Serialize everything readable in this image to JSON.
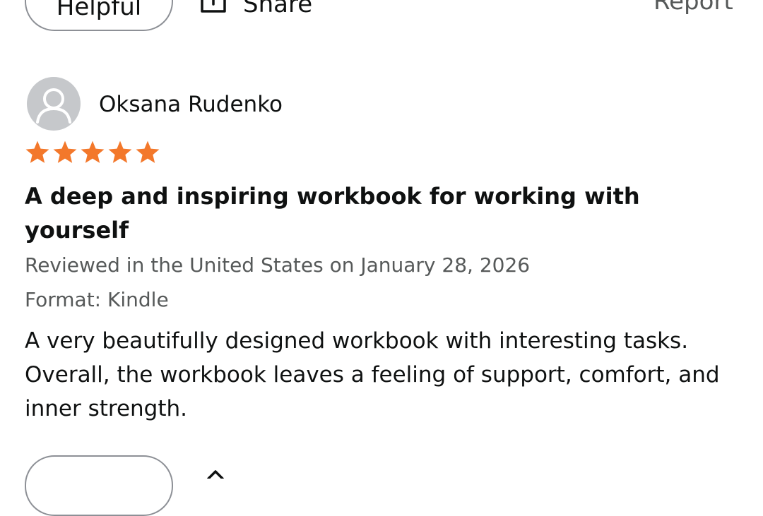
{
  "previous_review_actions": {
    "helpful_label": "Helpful",
    "share_label": "Share",
    "report_label": "Report"
  },
  "review": {
    "reviewer_name": "Oksana Rudenko",
    "rating": 5,
    "rating_max": 5,
    "star_color": "#f3782b",
    "title": "A deep and inspiring workbook for working with yourself",
    "reviewed_line": "Reviewed in the United States on January 28, 2026",
    "format_line": "Format: Kindle",
    "body": "A very beautifully designed workbook with interesting tasks. Overall, the workbook leaves a feeling of support, comfort, and inner strength."
  },
  "icons": {
    "avatar": "person-silhouette-icon",
    "share": "share-icon",
    "star": "star-icon"
  }
}
